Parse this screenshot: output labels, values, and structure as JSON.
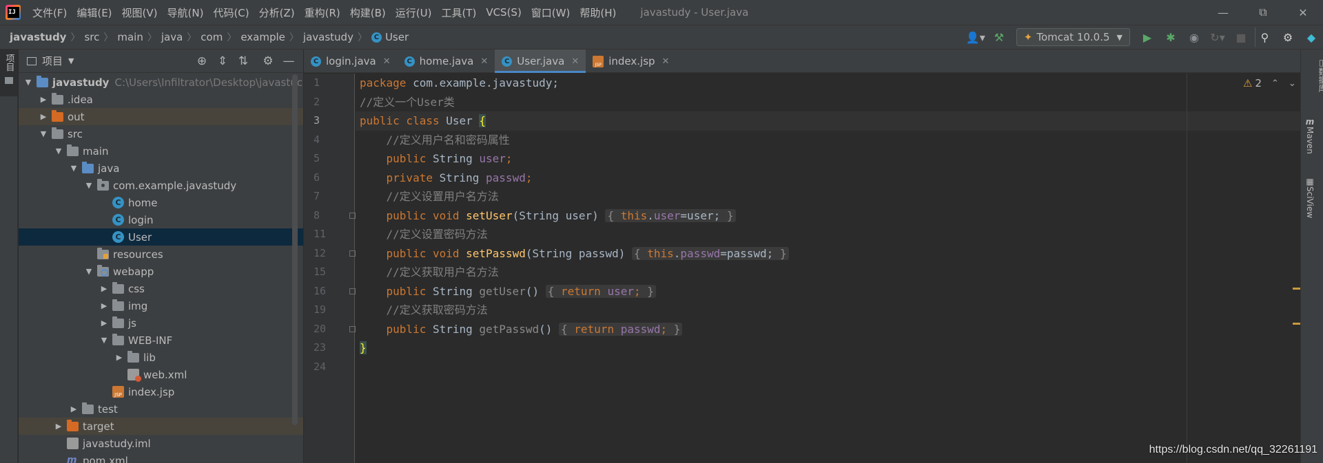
{
  "menu": {
    "items": [
      "文件(F)",
      "编辑(E)",
      "视图(V)",
      "导航(N)",
      "代码(C)",
      "分析(Z)",
      "重构(R)",
      "构建(B)",
      "运行(U)",
      "工具(T)",
      "VCS(S)",
      "窗口(W)",
      "帮助(H)"
    ],
    "window_title": "javastudy - User.java"
  },
  "breadcrumb": [
    "javastudy",
    "src",
    "main",
    "java",
    "com",
    "example",
    "javastudy",
    "User"
  ],
  "run_config": "Tomcat 10.0.5",
  "left_strip": {
    "label": "项目"
  },
  "project_panel": {
    "title": "项目",
    "root": {
      "name": "javastudy",
      "path": "C:\\Users\\Infiltrator\\Desktop\\javastuc"
    },
    "items": {
      "idea": ".idea",
      "out": "out",
      "src": "src",
      "main": "main",
      "java": "java",
      "package": "com.example.javastudy",
      "home": "home",
      "login": "login",
      "user": "User",
      "resources": "resources",
      "webapp": "webapp",
      "css": "css",
      "img": "img",
      "js": "js",
      "webinf": "WEB-INF",
      "lib": "lib",
      "webxml": "web.xml",
      "indexjsp": "index.jsp",
      "test": "test",
      "target": "target",
      "iml": "javastudy.iml",
      "pom": "pom.xml"
    }
  },
  "tabs": [
    "login.java",
    "home.java",
    "User.java",
    "index.jsp"
  ],
  "active_tab": "User.java",
  "line_numbers": [
    "1",
    "2",
    "3",
    "4",
    "5",
    "6",
    "7",
    "8",
    "11",
    "12",
    "15",
    "16",
    "19",
    "20",
    "23",
    "24"
  ],
  "code": {
    "l1a": "package",
    "l1b": " com.example.javastudy;",
    "l2": "//定义一个User类",
    "l3a": "public class",
    "l3b": " User ",
    "l3c": "{",
    "l4": "    //定义用户名和密码属性",
    "l5a": "    public",
    "l5b": " String ",
    "l5c": "user",
    "l5d": ";",
    "l6a": "    private",
    "l6b": " String ",
    "l6c": "passwd",
    "l6d": ";",
    "l7": "    //定义设置用户名方法",
    "l8a": "    public void",
    "l8b": "setUser",
    "l8c": "(String user) ",
    "l8d": "{",
    "l8e": "this",
    "l8f": ".",
    "l8g": "user",
    "l8h": "=user;",
    "l8i": "}",
    "l11": "    //定义设置密码方法",
    "l12a": "    public void",
    "l12b": "setPasswd",
    "l12c": "(String passwd) ",
    "l12d": "{",
    "l12e": "this",
    "l12f": ".",
    "l12g": "passwd",
    "l12h": "=passwd;",
    "l12i": "}",
    "l15": "    //定义获取用户名方法",
    "l16a": "    public",
    "l16b": " String ",
    "l16c": "getUser",
    "l16d": "() ",
    "l16e": "{",
    "l16f": "return",
    "l16g": "user",
    "l16h": ";",
    "l16i": "}",
    "l19": "    //定义获取密码方法",
    "l20a": "    public",
    "l20b": " String ",
    "l20c": "getPasswd",
    "l20d": "() ",
    "l20e": "{",
    "l20f": "return",
    "l20g": "passwd",
    "l20h": ";",
    "l20i": "}",
    "l23": "}"
  },
  "warnings": {
    "count": "2"
  },
  "right_strip": [
    "数据库",
    "Maven",
    "SciView"
  ],
  "watermark": "https://blog.csdn.net/qq_32261191",
  "colors": {
    "keyword": "#cc7832",
    "comment": "#808080",
    "field": "#9876aa",
    "method": "#ffc66d",
    "selection": "#0d293e",
    "accent": "#4a88c7"
  }
}
